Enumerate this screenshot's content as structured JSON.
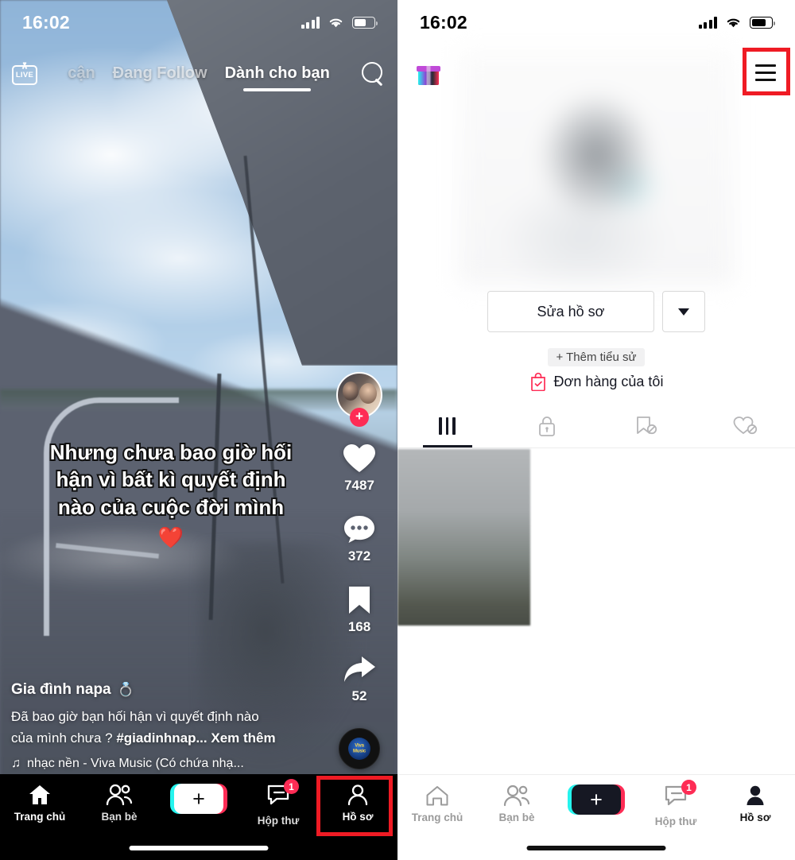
{
  "left_panel": {
    "status_bar": {
      "time": "16:02",
      "signal_icon": "cellular-bars-icon",
      "wifi_icon": "wifi-icon",
      "battery_icon": "battery-icon"
    },
    "top_nav": {
      "live_label": "LIVE",
      "tabs": [
        {
          "label": "cận",
          "active": false,
          "partial": true
        },
        {
          "label": "Đang Follow",
          "active": false
        },
        {
          "label": "Dành cho bạn",
          "active": true
        }
      ],
      "search_icon": "search-icon"
    },
    "actions": {
      "avatar_badge": "+",
      "items": [
        {
          "icon": "heart-icon",
          "count": "7487"
        },
        {
          "icon": "comment-icon",
          "count": "372"
        },
        {
          "icon": "bookmark-icon",
          "count": "168"
        },
        {
          "icon": "share-icon",
          "count": "52"
        }
      ],
      "music_disc_label": "Viva Music"
    },
    "subtitle": {
      "line1": "Nhưng chưa bao giờ hối",
      "line2": "hận vì bất kì quyết định",
      "line3": "nào của cuộc đời mình",
      "emoji": "❤️"
    },
    "caption": {
      "username": "Gia đình napa",
      "username_emoji": "💍",
      "text_line1": "Đã bao giờ bạn hối hận vì quyết định nào",
      "text_line2": "của mình chưa ? ",
      "hashtag": "#giadinhnap...",
      "more": "Xem thêm",
      "music_icon": "music-note-icon",
      "music": "nhạc nền - Viva Music (Có chứa nhạ..."
    },
    "tabbar": [
      {
        "label": "Trang chủ",
        "icon": "home-icon",
        "active": true,
        "badge": ""
      },
      {
        "label": "Bạn bè",
        "icon": "friends-icon",
        "active": false,
        "badge": ""
      },
      {
        "label": "",
        "icon": "create-plus-icon",
        "active": false,
        "badge": ""
      },
      {
        "label": "Hộp thư",
        "icon": "inbox-icon",
        "active": false,
        "badge": "1"
      },
      {
        "label": "Hồ sơ",
        "icon": "profile-person-icon",
        "active": true,
        "badge": ""
      }
    ]
  },
  "right_panel": {
    "status_bar": {
      "time": "16:02",
      "signal_icon": "cellular-bars-icon",
      "wifi_icon": "wifi-icon",
      "battery_icon": "battery-icon"
    },
    "header": {
      "gift_icon": "gift-icon",
      "menu_icon": "hamburger-menu-icon"
    },
    "profile": {
      "edit_button": "Sửa hồ sơ",
      "dropdown_icon": "chevron-down-icon",
      "add_bio": "+ Thêm tiểu sử",
      "orders_icon": "shopping-bag-icon",
      "orders_label": "Đơn hàng của tôi"
    },
    "tabs": [
      {
        "icon": "grid-icon",
        "active": true
      },
      {
        "icon": "lock-icon",
        "active": false
      },
      {
        "icon": "bookmark-hidden-icon",
        "active": false
      },
      {
        "icon": "heart-hidden-icon",
        "active": false
      }
    ],
    "tabbar": [
      {
        "label": "Trang chủ",
        "icon": "home-icon",
        "active": false,
        "badge": ""
      },
      {
        "label": "Bạn bè",
        "icon": "friends-icon",
        "active": false,
        "badge": ""
      },
      {
        "label": "",
        "icon": "create-plus-icon",
        "active": false,
        "badge": ""
      },
      {
        "label": "Hộp thư",
        "icon": "inbox-icon",
        "active": false,
        "badge": "1"
      },
      {
        "label": "Hồ sơ",
        "icon": "profile-person-icon",
        "active": true,
        "badge": ""
      }
    ]
  },
  "annotations": {
    "highlight_color": "#EF1B24",
    "boxes": [
      {
        "name": "profile-tab-highlight"
      },
      {
        "name": "hamburger-menu-highlight"
      }
    ]
  }
}
